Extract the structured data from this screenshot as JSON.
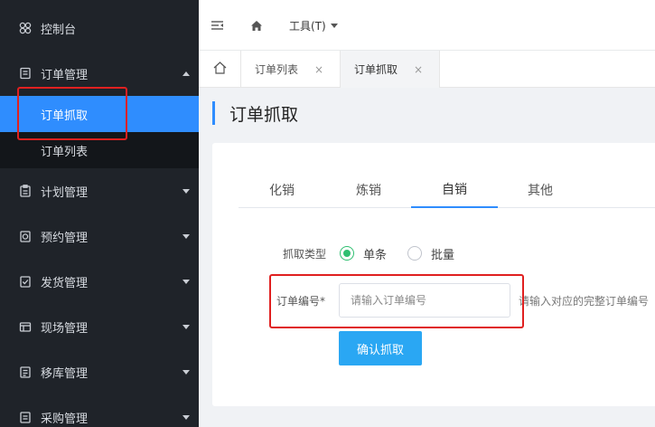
{
  "sidebar": {
    "items": [
      {
        "label": "控制台",
        "icon": "dashboard-icon"
      },
      {
        "label": "订单管理",
        "icon": "order-icon",
        "expanded": true
      },
      {
        "label": "计划管理",
        "icon": "plan-icon"
      },
      {
        "label": "预约管理",
        "icon": "reservation-icon"
      },
      {
        "label": "发货管理",
        "icon": "shipping-icon"
      },
      {
        "label": "现场管理",
        "icon": "site-icon"
      },
      {
        "label": "移库管理",
        "icon": "transfer-icon"
      },
      {
        "label": "采购管理",
        "icon": "purchase-icon"
      }
    ],
    "subitems": [
      {
        "label": "订单抓取",
        "active": true
      },
      {
        "label": "订单列表",
        "active": false
      }
    ]
  },
  "topbar": {
    "tools_label": "工具(T)"
  },
  "tabs": [
    {
      "label": "订单列表",
      "close": "×",
      "active": false
    },
    {
      "label": "订单抓取",
      "close": "×",
      "active": true
    }
  ],
  "page": {
    "title": "订单抓取",
    "subtabs": [
      "化销",
      "炼销",
      "自销",
      "其他"
    ],
    "active_subtab": "自销",
    "form": {
      "fetch_type_label": "抓取类型",
      "option_single": "单条",
      "option_batch": "批量",
      "selected_option": "单条",
      "order_no_label": "订单编号*",
      "order_no_value": "",
      "order_no_placeholder": "请输入订单编号",
      "hint": "请输入对应的完整订单编号",
      "confirm_button": "确认抓取"
    }
  },
  "colors": {
    "sidebar_bg": "#1f2329",
    "accent": "#2f8dfe",
    "button": "#2aa7f3",
    "radio_checked": "#2fbf71",
    "highlight_box": "#e02020"
  }
}
